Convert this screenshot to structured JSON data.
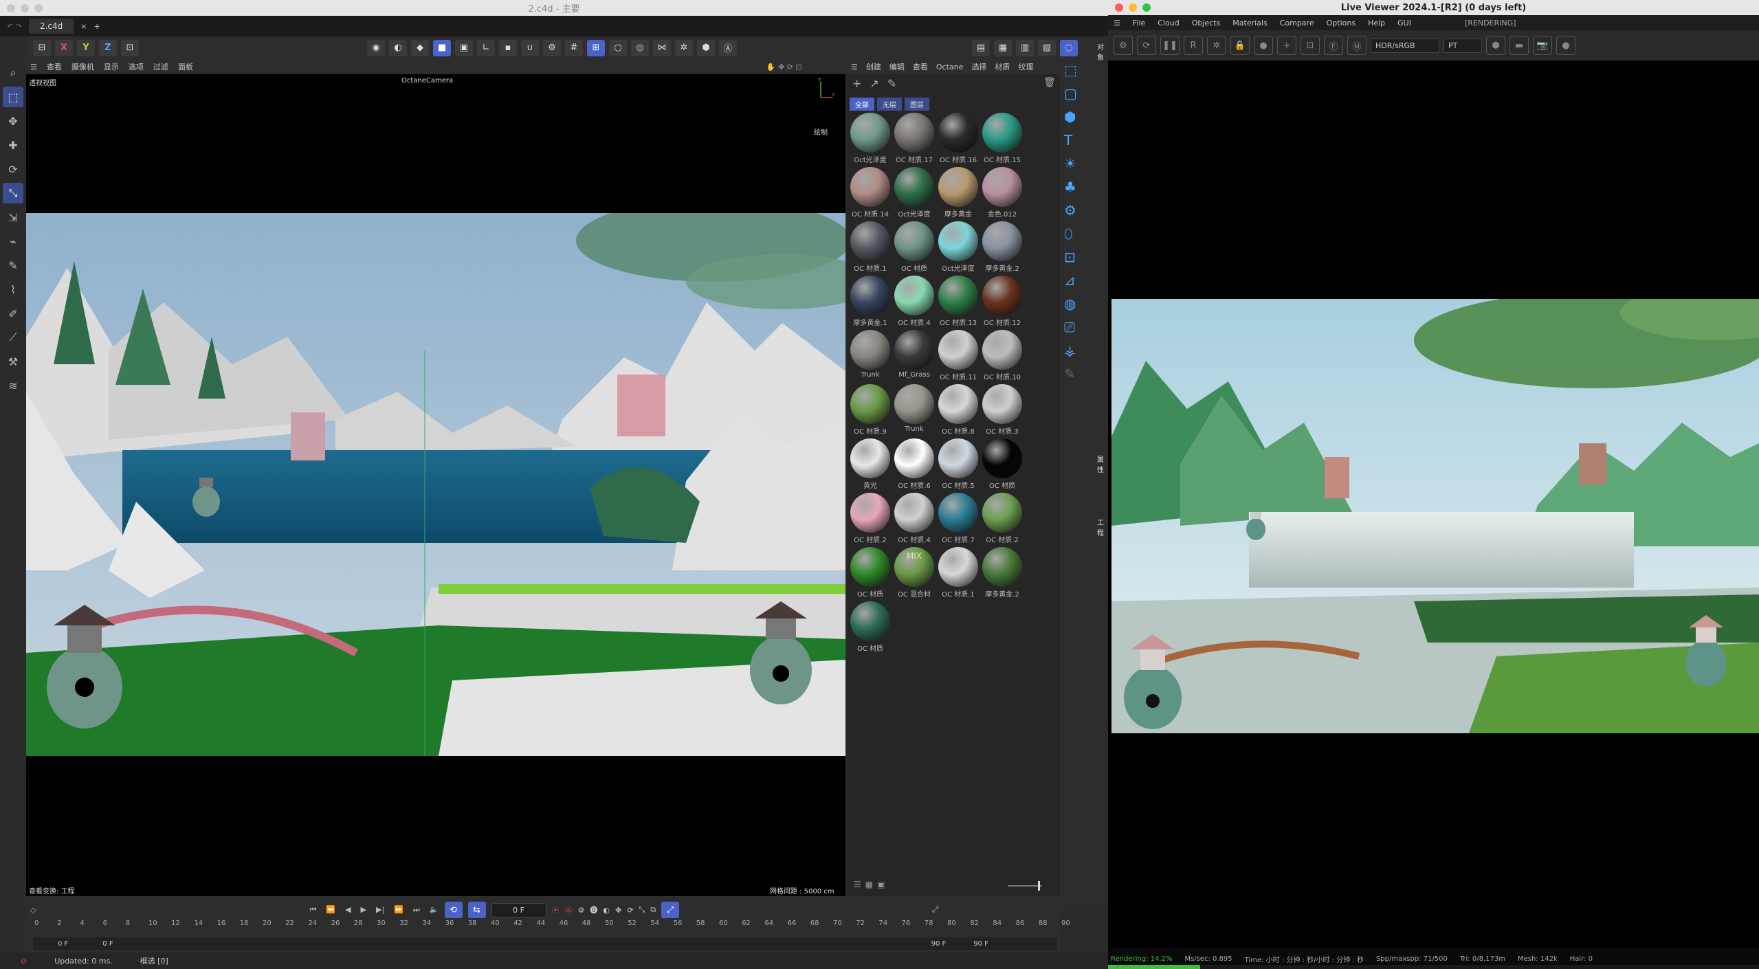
{
  "c4d": {
    "window_title": "2.c4d - 主要",
    "tab": "2.c4d",
    "axes": [
      "X",
      "Y",
      "Z"
    ],
    "viewport_menu": [
      "查看",
      "摄像机",
      "显示",
      "选项",
      "过滤",
      "面板"
    ],
    "viewport_label": "透视视图",
    "camera_label": "OctaneCamera",
    "draw_label": "绘制",
    "grid_label": "网格间距 : 5000 cm",
    "view_transform": "查看变换: 工程",
    "frame_display": "0 F",
    "frame_start": "0 F",
    "frame_start2": "0 F",
    "frame_end": "90 F",
    "frame_end2": "90 F",
    "ticks": [
      "0",
      "2",
      "4",
      "6",
      "8",
      "10",
      "12",
      "14",
      "16",
      "18",
      "20",
      "22",
      "24",
      "26",
      "28",
      "30",
      "32",
      "34",
      "36",
      "38",
      "40",
      "42",
      "44",
      "46",
      "48",
      "50",
      "52",
      "54",
      "56",
      "58",
      "60",
      "62",
      "64",
      "66",
      "68",
      "70",
      "72",
      "74",
      "76",
      "78",
      "80",
      "82",
      "84",
      "86",
      "88",
      "90"
    ],
    "status_updated": "Updated: 0 ms.",
    "status_select": "框选 [0]"
  },
  "material_manager": {
    "menu": [
      "创建",
      "编辑",
      "查看",
      "Octane",
      "选择",
      "材质",
      "纹理"
    ],
    "filters": [
      "全部",
      "无层",
      "图层"
    ],
    "right_labels": [
      "对象",
      "属性",
      "工程"
    ],
    "materials": [
      {
        "label": "Oct光泽度",
        "color": "#6f9a8a"
      },
      {
        "label": "OC 材质.17",
        "color": "#7a7672"
      },
      {
        "label": "OC 材质.16",
        "color": "#2a2a2a"
      },
      {
        "label": "OC 材质.15",
        "color": "#2c9a86"
      },
      {
        "label": "OC 材质.14",
        "color": "#b08c86"
      },
      {
        "label": "Oct光泽度",
        "color": "#2d6f4a"
      },
      {
        "label": "摩多黄金",
        "color": "#b89a70"
      },
      {
        "label": "金色.012",
        "color": "#b890a0"
      },
      {
        "label": "OC 材质.1",
        "color": "#555a62"
      },
      {
        "label": "OC 材质",
        "color": "#6f9488"
      },
      {
        "label": "Oct光泽度",
        "color": "#7ed6d8"
      },
      {
        "label": "摩多黄金.2",
        "color": "#8892a0"
      },
      {
        "label": "摩多黄金.1",
        "color": "#3a4662"
      },
      {
        "label": "OC 材质.4",
        "color": "#8ad8b2"
      },
      {
        "label": "OC 材质.13",
        "color": "#2f7f4a"
      },
      {
        "label": "OC 材质.12",
        "color": "#6a3420"
      },
      {
        "label": "Trunk",
        "color": "#8a8680"
      },
      {
        "label": "Mf_Grass",
        "color": "#3a3a3a"
      },
      {
        "label": "OC 材质.11",
        "color": "#d0d0d0"
      },
      {
        "label": "OC 材质.10",
        "color": "#bdbdbd"
      },
      {
        "label": "OC 材质.9",
        "color": "#6a9a48"
      },
      {
        "label": "Trunk",
        "color": "#9a948c"
      },
      {
        "label": "OC 材质.8",
        "color": "#d8d8d8"
      },
      {
        "label": "OC 材质.3",
        "color": "#cfcfcf"
      },
      {
        "label": "黄光",
        "color": "#e8e8e8"
      },
      {
        "label": "OC 材质.6",
        "color": "#ffffff"
      },
      {
        "label": "OC 材质.5",
        "color": "#d0d8e0"
      },
      {
        "label": "OC 材质",
        "color": "#050505"
      },
      {
        "label": "OC 材质.2",
        "color": "#e8a8b8"
      },
      {
        "label": "OC 材质.4",
        "color": "#d0d0d0"
      },
      {
        "label": "OC 材质.7",
        "color": "#2a7e94"
      },
      {
        "label": "OC 材质.2",
        "color": "#6aa050"
      },
      {
        "label": "OC 材质",
        "color": "#2f8a2a"
      },
      {
        "label": "OC 混合材",
        "color": "#6a9a48"
      },
      {
        "label": "OC 材质.1",
        "color": "#d8d8d8"
      },
      {
        "label": "摩多黄金.2",
        "color": "#4a7a3a"
      },
      {
        "label": "OC 材质",
        "color": "#2e6e58"
      }
    ],
    "mix_label": "MIX"
  },
  "live_viewer": {
    "window_title": "Live Viewer 2024.1-[R2] (0 days left)",
    "menu": [
      "File",
      "Cloud",
      "Objects",
      "Materials",
      "Compare",
      "Options",
      "Help",
      "GUI"
    ],
    "status_tag": "[RENDERING]",
    "color_space": "HDR/sRGB",
    "kernel": "PT",
    "stats": [
      "Rendering: 14.2%",
      "Ms/sec: 0.895",
      "Time: 小时 : 分钟 : 秒/小时 : 分钟 : 秒",
      "Spp/maxspp: 71/500",
      "Tri: 0/8.173m",
      "Mesh: 142k",
      "Hair: 0"
    ],
    "progress": 0.142
  }
}
